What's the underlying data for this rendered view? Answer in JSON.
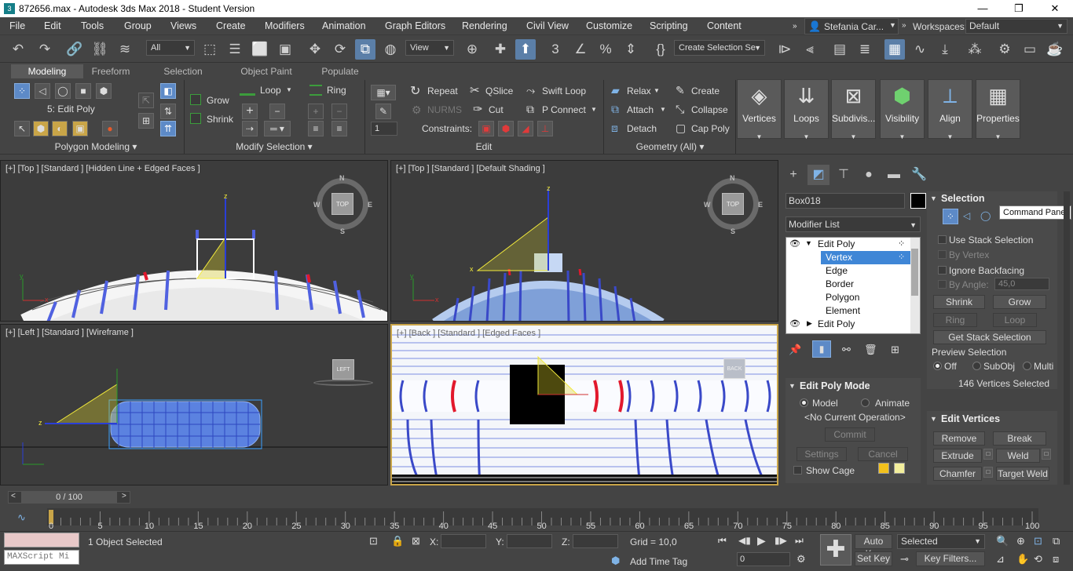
{
  "window": {
    "title": "872656.max - Autodesk 3ds Max 2018 - Student Version",
    "min": "—",
    "max": "❐",
    "close": "✕"
  },
  "menu": [
    "File",
    "Edit",
    "Tools",
    "Group",
    "Views",
    "Create",
    "Modifiers",
    "Animation",
    "Graph Editors",
    "Rendering",
    "Civil View",
    "Customize",
    "Scripting",
    "Content"
  ],
  "user": {
    "name": "Stefania Car...",
    "workspaces_label": "Workspaces:",
    "workspace": "Default"
  },
  "toolbar": {
    "filter": "All",
    "view": "View",
    "selection_set": "Create Selection Se"
  },
  "ribbon": {
    "tabs": [
      "Modeling",
      "Freeform",
      "Selection",
      "Object Paint",
      "Populate"
    ],
    "active_tab": "Modeling",
    "poly_label": "5: Edit Poly",
    "grow": "Grow",
    "shrink": "Shrink",
    "loop": "Loop",
    "ring": "Ring",
    "repeat": "Repeat",
    "qslice": "QSlice",
    "swift_loop": "Swift Loop",
    "nurms": "NURMS",
    "cut": "Cut",
    "p_connect": "P Connect",
    "spinner": "1",
    "constraints": "Constraints:",
    "relax": "Relax",
    "create": "Create",
    "attach": "Attach",
    "collapse": "Collapse",
    "detach": "Detach",
    "cap_poly": "Cap Poly",
    "footers": [
      "Polygon Modeling ▾",
      "Modify Selection ▾",
      "Edit",
      "Geometry (All) ▾"
    ],
    "big_buttons": [
      "Vertices",
      "Loops",
      "Subdivis...",
      "Visibility",
      "Align",
      "Properties"
    ]
  },
  "viewports": {
    "tl": "[+] [Top ] [Standard ] [Hidden Line + Edged Faces ]",
    "tr": "[+] [Top ] [Standard ] [Default Shading ]",
    "bl": "[+] [Left ] [Standard ] [Wireframe ]",
    "br": "[+] [Back ] [Standard ] [Edged Faces ]",
    "cube_top": "TOP",
    "cube_left": "LEFT",
    "cube_back": "BACK",
    "n": "N",
    "s": "S",
    "w": "W",
    "e": "E"
  },
  "command_panel": {
    "object_name": "Box018",
    "modifier_list": "Modifier List",
    "stack": [
      "Edit Poly",
      "Vertex",
      "Edge",
      "Border",
      "Polygon",
      "Element",
      "Edit Poly"
    ],
    "tooltip": "Command Panel",
    "selection": {
      "title": "Selection",
      "use_stack": "Use Stack Selection",
      "by_vertex": "By Vertex",
      "ignore_backfacing": "Ignore Backfacing",
      "by_angle": "By Angle:",
      "angle": "45,0",
      "shrink": "Shrink",
      "grow": "Grow",
      "ring": "Ring",
      "loop": "Loop",
      "get_stack": "Get Stack Selection",
      "preview": "Preview Selection",
      "off": "Off",
      "subobj": "SubObj",
      "multi": "Multi",
      "status": "146 Vertices Selected"
    },
    "edit_poly_mode": {
      "title": "Edit Poly Mode",
      "model": "Model",
      "animate": "Animate",
      "op": "<No Current Operation>",
      "commit": "Commit",
      "settings": "Settings",
      "cancel": "Cancel",
      "show_cage": "Show Cage"
    },
    "edit_vertices": {
      "title": "Edit Vertices",
      "remove": "Remove",
      "break": "Break",
      "extrude": "Extrude",
      "weld": "Weld",
      "chamfer": "Chamfer",
      "target_weld": "Target Weld"
    }
  },
  "timeline": {
    "frame": "0 / 100",
    "ticks": [
      "0",
      "5",
      "10",
      "15",
      "20",
      "25",
      "30",
      "35",
      "40",
      "45",
      "50",
      "55",
      "60",
      "65",
      "70",
      "75",
      "80",
      "85",
      "90",
      "95",
      "100"
    ]
  },
  "status": {
    "maxscript": "MAXScript Mi",
    "selected": "1 Object Selected",
    "x": "X:",
    "y": "Y:",
    "z": "Z:",
    "grid": "Grid = 10,0",
    "add_time_tag": "Add Time Tag",
    "auto_key": "Auto Key",
    "set_key": "Set Key",
    "key_mode": "Selected",
    "key_filters": "Key Filters...",
    "frame_field": "0"
  },
  "colors": {
    "accent": "#5d8ac7",
    "selected_vertex": "#e2182c",
    "mesh_blue": "#5061e0",
    "gizmo_yellow": "#f2ea3c"
  }
}
